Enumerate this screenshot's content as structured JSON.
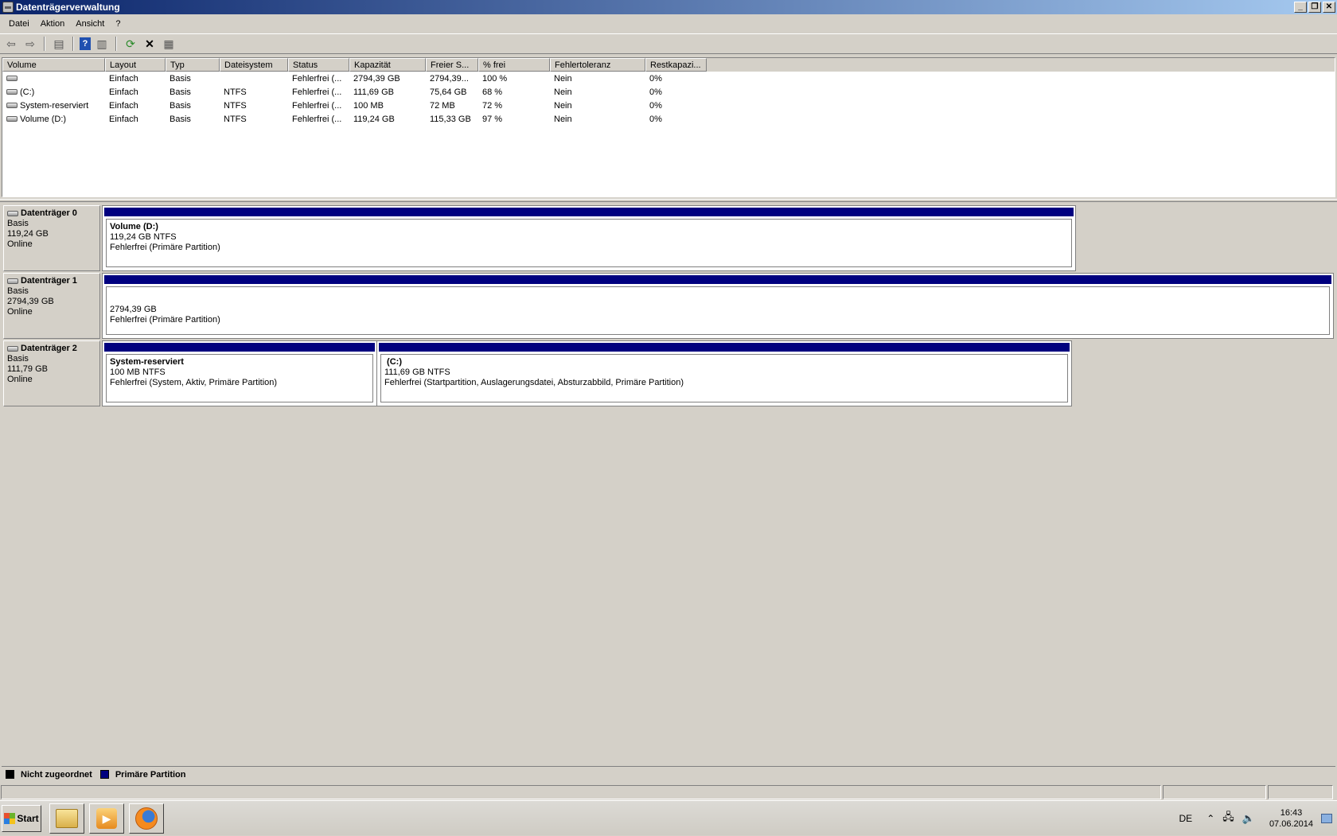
{
  "window": {
    "title": "Datenträgerverwaltung"
  },
  "menu": [
    "Datei",
    "Aktion",
    "Ansicht",
    "?"
  ],
  "volume_list": {
    "columns": [
      "Volume",
      "Layout",
      "Typ",
      "Dateisystem",
      "Status",
      "Kapazität",
      "Freier S...",
      "% frei",
      "Fehlertoleranz",
      "Restkapazi..."
    ],
    "rows": [
      [
        "",
        "Einfach",
        "Basis",
        "",
        "Fehlerfrei (...",
        "2794,39 GB",
        "2794,39...",
        "100 %",
        "Nein",
        "0%"
      ],
      [
        "(C:)",
        "Einfach",
        "Basis",
        "NTFS",
        "Fehlerfrei (...",
        "111,69 GB",
        "75,64 GB",
        "68 %",
        "Nein",
        "0%"
      ],
      [
        "System-reserviert",
        "Einfach",
        "Basis",
        "NTFS",
        "Fehlerfrei (...",
        "100 MB",
        "72 MB",
        "72 %",
        "Nein",
        "0%"
      ],
      [
        "Volume (D:)",
        "Einfach",
        "Basis",
        "NTFS",
        "Fehlerfrei (...",
        "119,24 GB",
        "115,33 GB",
        "97 %",
        "Nein",
        "0%"
      ]
    ]
  },
  "disks": [
    {
      "name": "Datenträger 0",
      "type": "Basis",
      "size": "119,24 GB",
      "state": "Online",
      "partitions": [
        {
          "name": "Volume  (D:)",
          "size": "119,24 GB NTFS",
          "status": "Fehlerfrei (Primäre Partition)"
        }
      ]
    },
    {
      "name": "Datenträger 1",
      "type": "Basis",
      "size": "2794,39 GB",
      "state": "Online",
      "partitions": [
        {
          "name": "",
          "size": "2794,39 GB",
          "status": "Fehlerfrei (Primäre Partition)"
        }
      ]
    },
    {
      "name": "Datenträger 2",
      "type": "Basis",
      "size": "111,79 GB",
      "state": "Online",
      "partitions": [
        {
          "name": "System-reserviert",
          "size": "100 MB NTFS",
          "status": "Fehlerfrei (System, Aktiv, Primäre Partition)"
        },
        {
          "name": " (C:)",
          "size": "111,69 GB NTFS",
          "status": "Fehlerfrei (Startpartition, Auslagerungsdatei, Absturzabbild, Primäre Partition)"
        }
      ]
    }
  ],
  "legend": {
    "unallocated": "Nicht zugeordnet",
    "primary": "Primäre Partition"
  },
  "colors": {
    "unallocated": "#000000",
    "primary": "#00007f"
  },
  "taskbar": {
    "start_label": "Start",
    "language": "DE",
    "time": "16:43",
    "date": "07.06.2014"
  }
}
